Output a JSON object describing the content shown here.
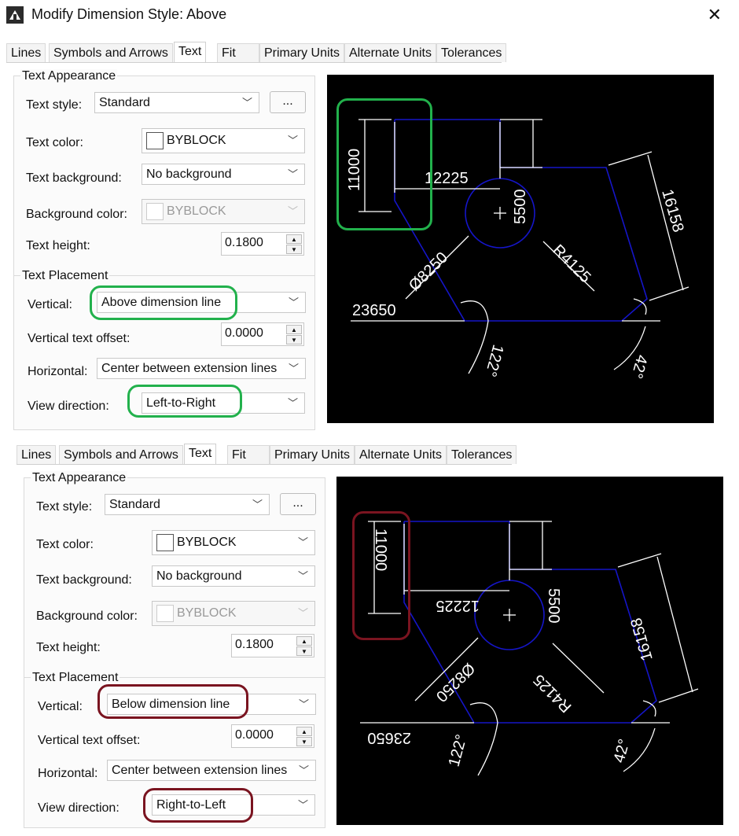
{
  "window": {
    "title": "Modify Dimension Style: Above",
    "close_icon": "close-icon",
    "app_icon": "dimension-style-icon"
  },
  "panels": [
    {
      "tabs": [
        "Lines",
        "Symbols and Arrows",
        "Text",
        "Fit",
        "Primary Units",
        "Alternate Units",
        "Tolerances"
      ],
      "active_tab": "Text",
      "text_appearance": {
        "title": "Text Appearance",
        "text_style_label": "Text style:",
        "text_style_value": "Standard",
        "browse_label": "...",
        "text_color_label": "Text color:",
        "text_color_value": "BYBLOCK",
        "text_background_label": "Text background:",
        "text_background_value": "No background",
        "background_color_label": "Background color:",
        "background_color_value": "BYBLOCK",
        "text_height_label": "Text height:",
        "text_height_value": "0.1800"
      },
      "text_placement": {
        "title": "Text Placement",
        "vertical_label": "Vertical:",
        "vertical_value": "Above dimension line",
        "offset_label": "Vertical text offset:",
        "offset_value": "0.0000",
        "horizontal_label": "Horizontal:",
        "horizontal_value": "Center between extension lines",
        "view_direction_label": "View direction:",
        "view_direction_value": "Left-to-Right"
      },
      "preview": {
        "d1": "11000",
        "d2": "12225",
        "d3": "5500",
        "d4": "16158",
        "d5": "Ø8250",
        "d6": "R4125",
        "d7": "23650",
        "d8": "122°",
        "d9": "42°"
      },
      "highlight_color": "#22b14c"
    },
    {
      "tabs": [
        "Lines",
        "Symbols and Arrows",
        "Text",
        "Fit",
        "Primary Units",
        "Alternate Units",
        "Tolerances"
      ],
      "active_tab": "Text",
      "text_appearance": {
        "title": "Text Appearance",
        "text_style_label": "Text style:",
        "text_style_value": "Standard",
        "browse_label": "...",
        "text_color_label": "Text color:",
        "text_color_value": "BYBLOCK",
        "text_background_label": "Text background:",
        "text_background_value": "No background",
        "background_color_label": "Background color:",
        "background_color_value": "BYBLOCK",
        "text_height_label": "Text height:",
        "text_height_value": "0.1800"
      },
      "text_placement": {
        "title": "Text Placement",
        "vertical_label": "Vertical:",
        "vertical_value": "Below dimension line",
        "offset_label": "Vertical text offset:",
        "offset_value": "0.0000",
        "horizontal_label": "Horizontal:",
        "horizontal_value": "Center between extension lines",
        "view_direction_label": "View direction:",
        "view_direction_value": "Right-to-Left"
      },
      "preview": {
        "d1": "11000",
        "d2": "12225",
        "d3": "5500",
        "d4": "16158",
        "d5": "Ø8250",
        "d6": "R4125",
        "d7": "23650",
        "d8": "122°",
        "d9": "42°"
      },
      "highlight_color": "#7a1420"
    }
  ]
}
